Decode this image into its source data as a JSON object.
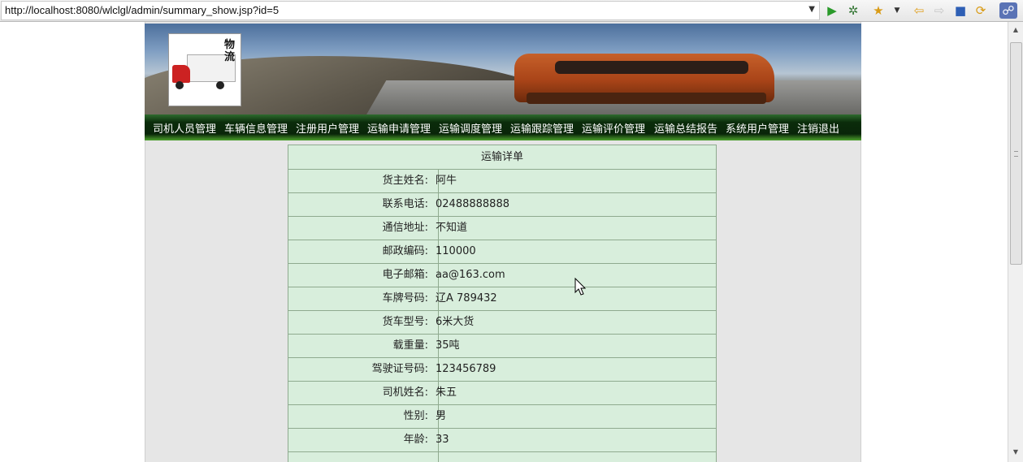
{
  "browser": {
    "url": "http://localhost:8080/wlclgl/admin/summary_show.jsp?id=5",
    "icons": [
      "dropdown-arrow-icon",
      "run-icon",
      "debug-icon",
      "favorites-icon",
      "back-icon",
      "forward-icon",
      "stop-icon",
      "refresh-icon",
      "eclipse-icon"
    ]
  },
  "logo": {
    "text": "物流"
  },
  "nav": {
    "items": [
      {
        "label": "司机人员管理"
      },
      {
        "label": "车辆信息管理"
      },
      {
        "label": "注册用户管理"
      },
      {
        "label": "运输申请管理"
      },
      {
        "label": "运输调度管理"
      },
      {
        "label": "运输跟踪管理"
      },
      {
        "label": "运输评价管理"
      },
      {
        "label": "运输总结报告"
      },
      {
        "label": "系统用户管理"
      },
      {
        "label": "注销退出"
      }
    ]
  },
  "detail": {
    "caption": "运输详单",
    "rows": [
      {
        "label": "货主姓名:",
        "value": "阿牛"
      },
      {
        "label": "联系电话:",
        "value": "02488888888"
      },
      {
        "label": "通信地址:",
        "value": "不知道"
      },
      {
        "label": "邮政编码:",
        "value": "110000"
      },
      {
        "label": "电子邮箱:",
        "value": "aa@163.com"
      },
      {
        "label": "车牌号码:",
        "value": "辽A 789432"
      },
      {
        "label": "货车型号:",
        "value": "6米大货"
      },
      {
        "label": "载重量:",
        "value": "35吨"
      },
      {
        "label": "驾驶证号码:",
        "value": "123456789"
      },
      {
        "label": "司机姓名:",
        "value": "朱五"
      },
      {
        "label": "性别:",
        "value": "男"
      },
      {
        "label": "年龄:",
        "value": "33"
      }
    ]
  }
}
